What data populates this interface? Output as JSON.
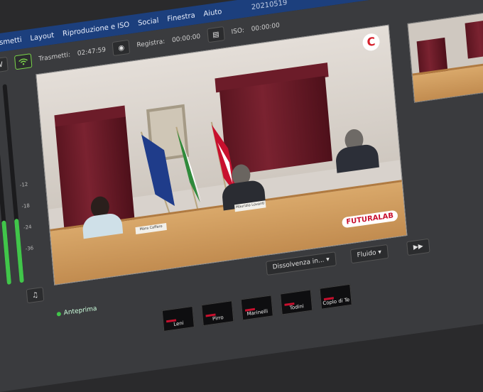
{
  "menu": {
    "items": [
      "Trasmetti",
      "Layout",
      "Riproduzione e ISO",
      "Social",
      "Finestra",
      "Aiuto"
    ],
    "document_title": "20210519"
  },
  "toolbar": {
    "stream_label": "Trasmetti:",
    "stream_time": "02:47:59",
    "record_label": "Registra:",
    "record_time": "00:00:00",
    "iso_label": "ISO:",
    "iso_time": "00:00:00"
  },
  "meter": {
    "ticks": [
      "-12",
      "-18",
      "-24",
      "-36"
    ],
    "level": 0.32
  },
  "preview": {
    "logo_letter": "C",
    "watermark": "FUTURALAB",
    "nameplates": [
      "Mara Caffaro",
      "Maurizio Lovanti",
      ""
    ]
  },
  "controls": {
    "transition": "Dissolvenza in...",
    "mode": "Fluido",
    "go_symbol": "▶▶"
  },
  "anteprima_label": "Anteprima",
  "sources": [
    "Leni",
    "Pirro",
    "Marinelli",
    "Todini",
    "Coplo di Te"
  ],
  "colors": {
    "menubar": "#1c3f7d",
    "meter_green": "#41c64a",
    "accent_red": "#c8102e"
  }
}
